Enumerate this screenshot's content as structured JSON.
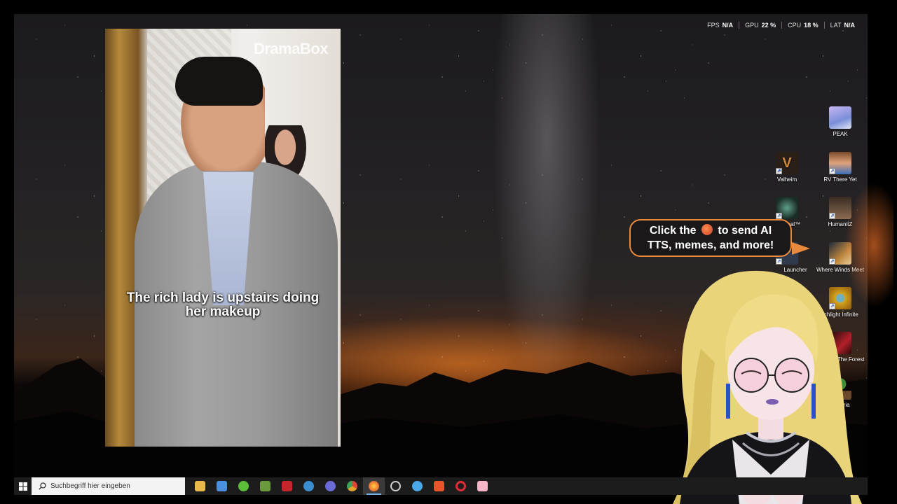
{
  "stats": [
    {
      "label": "FPS",
      "value": "N/A"
    },
    {
      "label": "GPU",
      "value": "22 %"
    },
    {
      "label": "CPU",
      "value": "18 %"
    },
    {
      "label": "LAT",
      "value": "N/A"
    }
  ],
  "video": {
    "brand": "DramaBox",
    "subtitle_line1": "The rich lady is upstairs doing",
    "subtitle_line2": "her makeup"
  },
  "desktop_icons": [
    {
      "label": "PEAK",
      "icon": "peak-icon",
      "color": "#9aa6e0"
    },
    {
      "label": "Valheim",
      "icon": "valheim-icon",
      "color": "#3b2a1c"
    },
    {
      "label": "RV There Yet",
      "icon": "rv-there-yet-icon",
      "color": "#d98a5c"
    },
    {
      "label": "Returnal™",
      "icon": "returnal-icon",
      "color": "#2e4b3a"
    },
    {
      "label": "HumanitZ",
      "icon": "humanitz-icon",
      "color": "#5b4636"
    },
    {
      "label": "Launcher",
      "icon": "launcher-icon",
      "color": "#3d4d66"
    },
    {
      "label": "Where Winds Meet",
      "icon": "where-winds-meet-icon",
      "color": "#c0883f"
    },
    {
      "label": "rchlight Infinite",
      "icon": "torchlight-infinite-icon",
      "color": "#d6a41e"
    },
    {
      "label": "Of The Forest",
      "icon": "sons-of-the-forest-icon",
      "color": "#b3202a"
    },
    {
      "label": "Terraria",
      "icon": "terraria-icon",
      "color": "#3e8e3a"
    }
  ],
  "bubble": {
    "part1": "Click the",
    "part2": "to send AI",
    "line2": "TTS, memes, and more!"
  },
  "taskbar": {
    "search_placeholder": "Suchbegriff hier eingeben",
    "apps": [
      {
        "name": "file-explorer-icon",
        "color": "#e8b84a"
      },
      {
        "name": "store-icon",
        "color": "#4a8fe0"
      },
      {
        "name": "game-icon",
        "color": "#5bbf3a"
      },
      {
        "name": "minecraft-icon",
        "color": "#6a9a3c"
      },
      {
        "name": "ubisoft-icon",
        "color": "#c4262b"
      },
      {
        "name": "steam-icon",
        "color": "#3b8fd0"
      },
      {
        "name": "discord-icon",
        "color": "#6b6bd8"
      },
      {
        "name": "chrome-icon",
        "color": "#e0a52a"
      },
      {
        "name": "firefox-icon",
        "color": "#ee7a2a"
      },
      {
        "name": "obs-icon",
        "color": "#cfcfcf"
      },
      {
        "name": "battle-net-icon",
        "color": "#4aa7e8"
      },
      {
        "name": "brave-icon",
        "color": "#e8552a"
      },
      {
        "name": "opera-icon",
        "color": "#e02a35"
      },
      {
        "name": "pink-app-icon",
        "color": "#f4b6c8"
      }
    ],
    "active_index": 8
  }
}
